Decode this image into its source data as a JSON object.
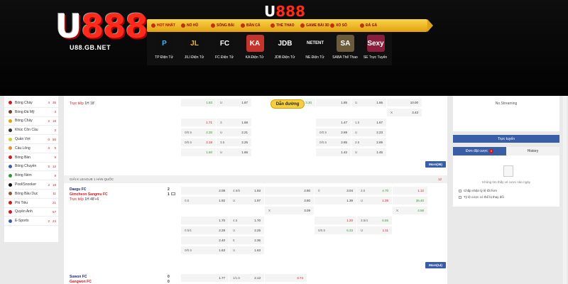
{
  "header": {
    "brand_u": "U",
    "brand_888": "888",
    "brand_sub": "U88.GB.NET",
    "center_u": "U",
    "center_888": "888"
  },
  "nav": [
    {
      "label": "HOT NHẤT",
      "active": true
    },
    {
      "label": "NỔ HŨ"
    },
    {
      "label": "SÒNG BÀI"
    },
    {
      "label": "BẮN CÁ"
    },
    {
      "label": "THỂ THAO"
    },
    {
      "label": "GAME BÀI 3D"
    },
    {
      "label": "XỔ SỐ"
    },
    {
      "label": "ĐÁ GÀ"
    }
  ],
  "submenu": [
    {
      "glyph": "P",
      "label": "TP Điện Tử",
      "bg": "#0f0f0f",
      "fg": "#36b8ff"
    },
    {
      "glyph": "JL",
      "label": "JILI Điện Tử",
      "bg": "#0f0f0f",
      "fg": "#f2b531"
    },
    {
      "glyph": "FC",
      "label": "FC Điện Tử",
      "bg": "#0f0f0f",
      "fg": "#ffffff"
    },
    {
      "glyph": "KA",
      "label": "KA Điện Tử",
      "bg": "#c5342b",
      "fg": "#ffffff"
    },
    {
      "glyph": "JDB",
      "label": "JDB Điện Tử",
      "bg": "#0f0f0f",
      "fg": "#ffffff"
    },
    {
      "glyph": "NETENT",
      "label": "NE Điện Tử",
      "bg": "#0f0f0f",
      "fg": "#ffffff"
    },
    {
      "glyph": "SA",
      "label": "SABA Thể Thao",
      "bg": "#6b5a3c",
      "fg": "#ffffff"
    },
    {
      "glyph": "Sexy",
      "label": "SE Trực Tuyến",
      "bg": "#8a1f3d",
      "fg": "#ffffff"
    }
  ],
  "sidebar": [
    {
      "label": "Bóng Chày",
      "count": "4",
      "count2": "35",
      "color": "#d4161d"
    },
    {
      "label": "Bóng Đá Mỹ",
      "count": "",
      "count2": "3",
      "color": "#6b4226"
    },
    {
      "label": "Bóng Chày",
      "count": "2",
      "count2": "18",
      "color": "#e0a800"
    },
    {
      "label": "Khúc Côn Cầu",
      "count": "",
      "count2": "3",
      "color": "#333333"
    },
    {
      "label": "Quần Vợt",
      "count": "0",
      "count2": "56",
      "color": "#c5d82b"
    },
    {
      "label": "Cầu Lông",
      "count": "3",
      "count2": "9",
      "color": "#f08a24"
    },
    {
      "label": "Bóng Bàn",
      "count": "",
      "count2": "9",
      "color": "#d4161d"
    },
    {
      "label": "Bóng Chuyền",
      "count": "5",
      "count2": "12",
      "color": "#3a5da8"
    },
    {
      "label": "Bóng Ném",
      "count": "",
      "count2": "9",
      "color": "#2e9a2e"
    },
    {
      "label": "Pool/Snooker",
      "count": "2",
      "count2": "18",
      "color": "#111111"
    },
    {
      "label": "Bóng Bầu Dục",
      "count": "",
      "count2": "11",
      "color": "#8a5a2b"
    },
    {
      "label": "Phi Tiêu",
      "count": "",
      "count2": "21",
      "color": "#d4161d"
    },
    {
      "label": "Quyền Anh",
      "count": "",
      "count2": "57",
      "color": "#d4161d"
    },
    {
      "label": "E-Sports",
      "count": "2",
      "count2": "24",
      "color": "#3a5da8"
    }
  ],
  "match1": {
    "live": "Trực tiếp",
    "time": "1H 18'",
    "rows": [
      [
        {
          "h": "",
          "v": "1.83",
          "c": "green"
        },
        {
          "h": "U",
          "v": "1.87"
        },
        {
          "h": "",
          "v": ""
        },
        {
          "h": "X",
          "v": "3.30",
          "c": "green"
        },
        {
          "h": "",
          "v": "1.85"
        },
        {
          "h": "U",
          "v": "1.86"
        },
        {
          "h": "",
          "v": "10.00"
        }
      ],
      [
        {
          "h": "",
          "v": ""
        },
        {
          "h": "",
          "v": ""
        },
        {
          "h": "",
          "v": ""
        },
        {
          "h": "",
          "v": ""
        },
        {
          "h": "",
          "v": ""
        },
        {
          "h": "",
          "v": ""
        },
        {
          "h": "X",
          "v": "3.43"
        }
      ],
      [
        {
          "h": "",
          "v": "1.71",
          "c": "red"
        },
        {
          "h": "3",
          "v": "1.68"
        },
        {
          "h": "",
          "v": ""
        },
        {
          "h": "",
          "v": ""
        },
        {
          "h": "",
          "v": "1.47"
        },
        {
          "h": "1.5",
          "v": "1.67"
        },
        {
          "h": "",
          "v": ""
        }
      ],
      [
        {
          "h": "0/0.5",
          "v": "2.30",
          "c": "green"
        },
        {
          "h": "U",
          "v": "2.21"
        },
        {
          "h": "",
          "v": ""
        },
        {
          "h": "",
          "v": ""
        },
        {
          "h": "0/0.5",
          "v": "2.69"
        },
        {
          "h": "U",
          "v": "2.23"
        },
        {
          "h": "",
          "v": ""
        }
      ],
      [
        {
          "h": "0/0.5",
          "v": "2.18",
          "c": "red"
        },
        {
          "h": "3.5",
          "v": "2.25"
        },
        {
          "h": "",
          "v": ""
        },
        {
          "h": "",
          "v": ""
        },
        {
          "h": "0/0.5",
          "v": "2.85"
        },
        {
          "h": "2.5",
          "v": "2.69"
        },
        {
          "h": "",
          "v": ""
        }
      ],
      [
        {
          "h": "",
          "v": "1.60",
          "c": "green"
        },
        {
          "h": "U",
          "v": "1.66"
        },
        {
          "h": "",
          "v": ""
        },
        {
          "h": "",
          "v": ""
        },
        {
          "h": "",
          "v": "1.42"
        },
        {
          "h": "U",
          "v": "1.45"
        },
        {
          "h": "",
          "v": ""
        }
      ]
    ],
    "more": "More(36)"
  },
  "guide_label": "Dẫn đường",
  "league2": {
    "name": "GIẢI K LEAGUE 1 HÀN QUỐC",
    "num": "12"
  },
  "match2": {
    "team_a": "Daegu FC",
    "team_b": "Gimcheon Sangmu FC",
    "score_a": "2",
    "score_b": "1",
    "live": "Trực tiếp",
    "time": "1H 48'+6",
    "rows": [
      [
        {
          "h": "",
          "v": "2.08"
        },
        {
          "h": "4.5/5",
          "v": "1.93"
        },
        {
          "h": "",
          "v": "2.80"
        },
        {
          "h": "0",
          "v": "3.04"
        },
        {
          "h": "3.5",
          "v": "4.70",
          "c": "green"
        },
        {
          "h": "",
          "v": "1.12",
          "c": "red"
        }
      ],
      [
        {
          "h": "0.5",
          "v": "1.92"
        },
        {
          "h": "U",
          "v": "1.97"
        },
        {
          "h": "",
          "v": "3.80"
        },
        {
          "h": "",
          "v": "1.39"
        },
        {
          "h": "U",
          "v": "1.39",
          "c": "red"
        },
        {
          "h": "",
          "v": "36.40",
          "c": "green"
        }
      ],
      [
        {
          "h": "",
          "v": ""
        },
        {
          "h": "",
          "v": ""
        },
        {
          "h": "X",
          "v": "3.09"
        },
        {
          "h": "",
          "v": ""
        },
        {
          "h": "",
          "v": ""
        },
        {
          "h": "X",
          "v": "4.58",
          "c": "green"
        }
      ],
      [
        {
          "h": "",
          "v": "1.70"
        },
        {
          "h": "4.5",
          "v": "1.70"
        },
        {
          "h": "",
          "v": ""
        },
        {
          "h": "",
          "v": "1.20",
          "c": "red"
        },
        {
          "h": "3.5/4",
          "v": "6.55",
          "c": "green"
        },
        {
          "h": "",
          "v": ""
        }
      ],
      [
        {
          "h": "0.5/1",
          "v": "2.28"
        },
        {
          "h": "U",
          "v": "2.25"
        },
        {
          "h": "",
          "v": ""
        },
        {
          "h": "0/0.5",
          "v": "6.33",
          "c": "green"
        },
        {
          "h": "U",
          "v": "1.11",
          "c": "red"
        },
        {
          "h": "",
          "v": ""
        }
      ],
      [
        {
          "h": "",
          "v": "2.40"
        },
        {
          "h": "5",
          "v": "2.36"
        },
        {
          "h": "",
          "v": ""
        },
        {
          "h": "",
          "v": ""
        },
        {
          "h": "",
          "v": ""
        },
        {
          "h": "",
          "v": ""
        }
      ],
      [
        {
          "h": "0/0.5",
          "v": "1.63"
        },
        {
          "h": "U",
          "v": "1.63"
        },
        {
          "h": "",
          "v": ""
        },
        {
          "h": "",
          "v": ""
        },
        {
          "h": "",
          "v": ""
        },
        {
          "h": "",
          "v": ""
        }
      ]
    ],
    "more": "More(14)"
  },
  "match3": {
    "team_a": "Suwon FC",
    "team_b": "Gangwon FC",
    "score_a": "0",
    "score_b": "0",
    "rows": [
      [
        {
          "h": "",
          "v": "1.77"
        },
        {
          "h": "1/1.5",
          "v": "2.13"
        },
        {
          "h": "",
          "v": "3.74",
          "c": "red"
        }
      ]
    ]
  },
  "right": {
    "stream_text": "No Streaming",
    "live_tv": "Trực tuyến",
    "tab_slip": "Đơn đặt cược",
    "tab_slip_count": "0",
    "tab_history": "History",
    "empty": "Không tìm thấy vé cược nào ngày",
    "opt1": "Chấp nhận tỷ lệ tốt hơn",
    "opt2": "Tỷ lệ cược có thể bị thay đổi"
  }
}
